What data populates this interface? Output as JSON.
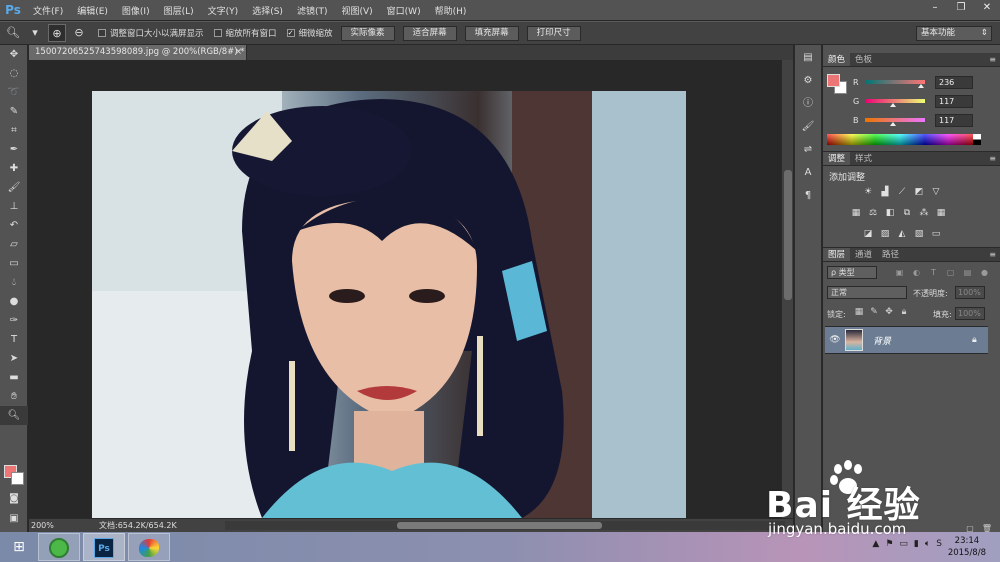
{
  "app": {
    "logo": "Ps"
  },
  "menu": [
    "文件(F)",
    "编辑(E)",
    "图像(I)",
    "图层(L)",
    "文字(Y)",
    "选择(S)",
    "滤镜(T)",
    "视图(V)",
    "窗口(W)",
    "帮助(H)"
  ],
  "options": {
    "check_resize": "调整窗口大小以满屏显示",
    "check_zoom_all": "缩放所有窗口",
    "check_scrubby": "细微缩放",
    "btn_actual": "实际像素",
    "btn_fit": "适合屏幕",
    "btn_fill": "填充屏幕",
    "btn_print": "打印尺寸",
    "workspace": "基本功能"
  },
  "document": {
    "tab_title": "15007206525743598089.jpg @ 200%(RGB/8#) *",
    "zoom": "200%",
    "doc_size": "文档:654.2K/654.2K"
  },
  "color_panel": {
    "tabs": [
      "颜色",
      "色板"
    ],
    "fg_color": "#ec7575",
    "bg_color": "#ffffff",
    "R": {
      "label": "R",
      "value": "236"
    },
    "G": {
      "label": "G",
      "value": "117"
    },
    "B": {
      "label": "B",
      "value": "117"
    }
  },
  "adjust_panel": {
    "tabs": [
      "调整",
      "样式"
    ],
    "title": "添加调整"
  },
  "layers_panel": {
    "tabs": [
      "图层",
      "通道",
      "路径"
    ],
    "filter": "ρ 类型",
    "blend_mode": "正常",
    "opacity_label": "不透明度:",
    "opacity_value": "100%",
    "lock_label": "锁定:",
    "fill_label": "填充:",
    "fill_value": "100%",
    "layer_name": "背景"
  },
  "taskbar": {
    "time": "23:14",
    "date": "2015/8/8",
    "ps_label": "Ps"
  },
  "watermark": {
    "brand": "Bai  经验",
    "url": "jingyan.baidu.com"
  }
}
